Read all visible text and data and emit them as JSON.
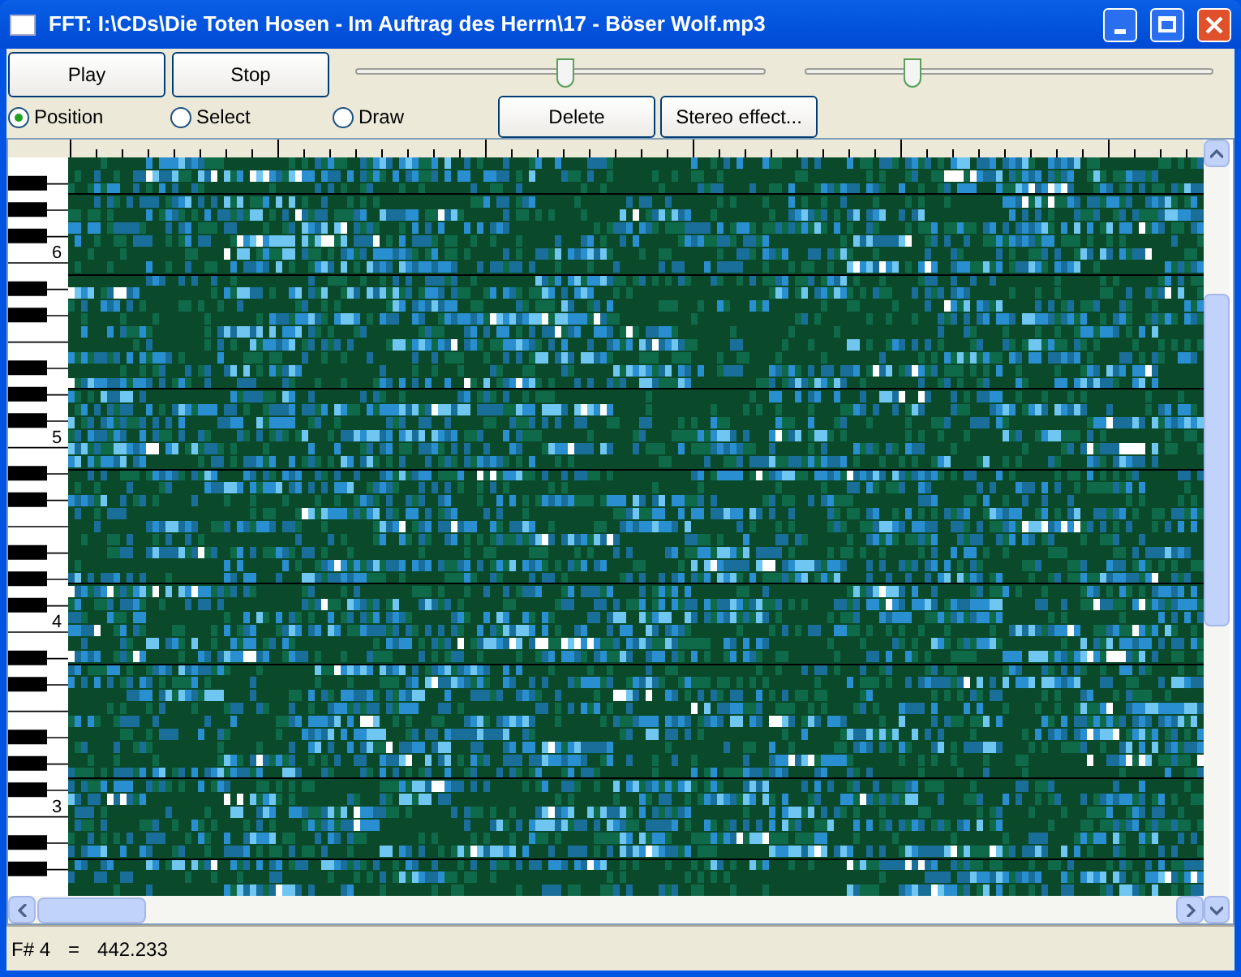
{
  "window": {
    "title": "FFT: I:\\CDs\\Die Toten Hosen - Im Auftrag des Herrn\\17 - Böser Wolf.mp3"
  },
  "buttons": [
    {
      "label": "Play"
    },
    {
      "label": "Stop"
    }
  ],
  "sliders": [
    {
      "level": 0.51
    },
    {
      "level": 0.26
    }
  ],
  "modes": [
    {
      "label": "Position",
      "selected": true
    },
    {
      "label": "Select",
      "selected": false
    },
    {
      "label": "Draw",
      "selected": false
    }
  ],
  "actions": [
    {
      "label": "Delete"
    },
    {
      "label": "Stereo effect..."
    }
  ],
  "keyboard": {
    "octave_labels": [
      "6",
      "5",
      "4",
      "3"
    ]
  },
  "status_bar": {
    "note": "F# 4",
    "equals": "=",
    "frequency": "442.233"
  }
}
